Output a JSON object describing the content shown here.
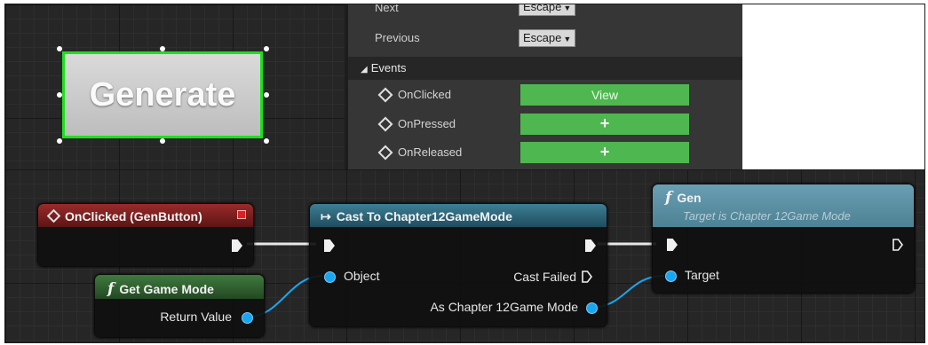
{
  "designer": {
    "button_text": "Generate"
  },
  "details": {
    "rows": [
      {
        "label": "Next",
        "value": "Escape"
      },
      {
        "label": "Previous",
        "value": "Escape"
      }
    ],
    "events_header": "Events",
    "events": [
      {
        "label": "OnClicked",
        "action": "View"
      },
      {
        "label": "OnPressed",
        "action": "+"
      },
      {
        "label": "OnReleased",
        "action": "+"
      }
    ]
  },
  "graph": {
    "event_node": {
      "title": "OnClicked (GenButton)"
    },
    "get_game_mode": {
      "title": "Get Game Mode",
      "output": "Return Value"
    },
    "cast_node": {
      "title": "Cast To Chapter12GameMode",
      "input": "Object",
      "failed": "Cast Failed",
      "output": "As Chapter 12Game Mode"
    },
    "gen_node": {
      "title": "Gen",
      "subtitle": "Target is Chapter 12Game Mode",
      "input": "Target"
    }
  },
  "colors": {
    "exec_green": "#4fb74f",
    "selection": "#1ee01e",
    "data_pin": "#19a6f0"
  }
}
